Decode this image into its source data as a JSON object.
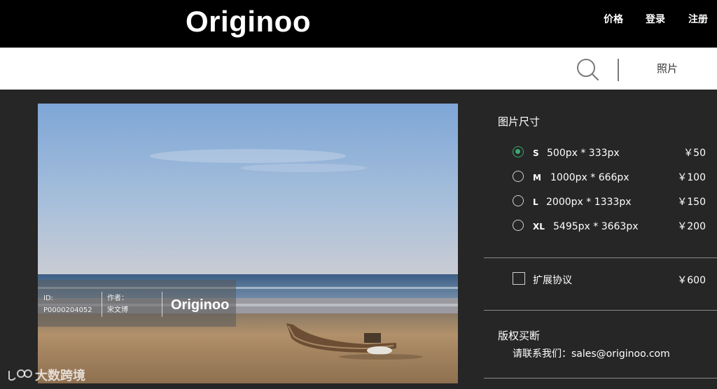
{
  "header": {
    "logo": "Originoo",
    "nav": {
      "pricing": "价格",
      "login": "登录",
      "register": "注册"
    }
  },
  "searchbar": {
    "category": "照片"
  },
  "photo": {
    "id_label": "ID:",
    "id_value": "P0000204052",
    "author_label": "作者：",
    "author_value": "宋文博",
    "watermark_logo": "Originoo"
  },
  "panel": {
    "size_title": "图片尺寸",
    "options": [
      {
        "code": "S",
        "dims": "500px * 333px",
        "price": "￥50",
        "selected": true
      },
      {
        "code": "M",
        "dims": "1000px * 666px",
        "price": "￥100",
        "selected": false
      },
      {
        "code": "L",
        "dims": "2000px * 1333px",
        "price": "￥150",
        "selected": false
      },
      {
        "code": "XL",
        "dims": "5495px * 3663px",
        "price": "￥200",
        "selected": false
      }
    ],
    "extension": {
      "label": "扩展协议",
      "price": "￥600",
      "checked": false
    },
    "buyout_title": "版权买断",
    "contact": "请联系我们：sales@originoo.com"
  },
  "site_watermark": {
    "text": "大数跨境"
  },
  "colors": {
    "accent": "#3aaa72",
    "header_bg": "#000000",
    "panel_bg": "#262626"
  }
}
